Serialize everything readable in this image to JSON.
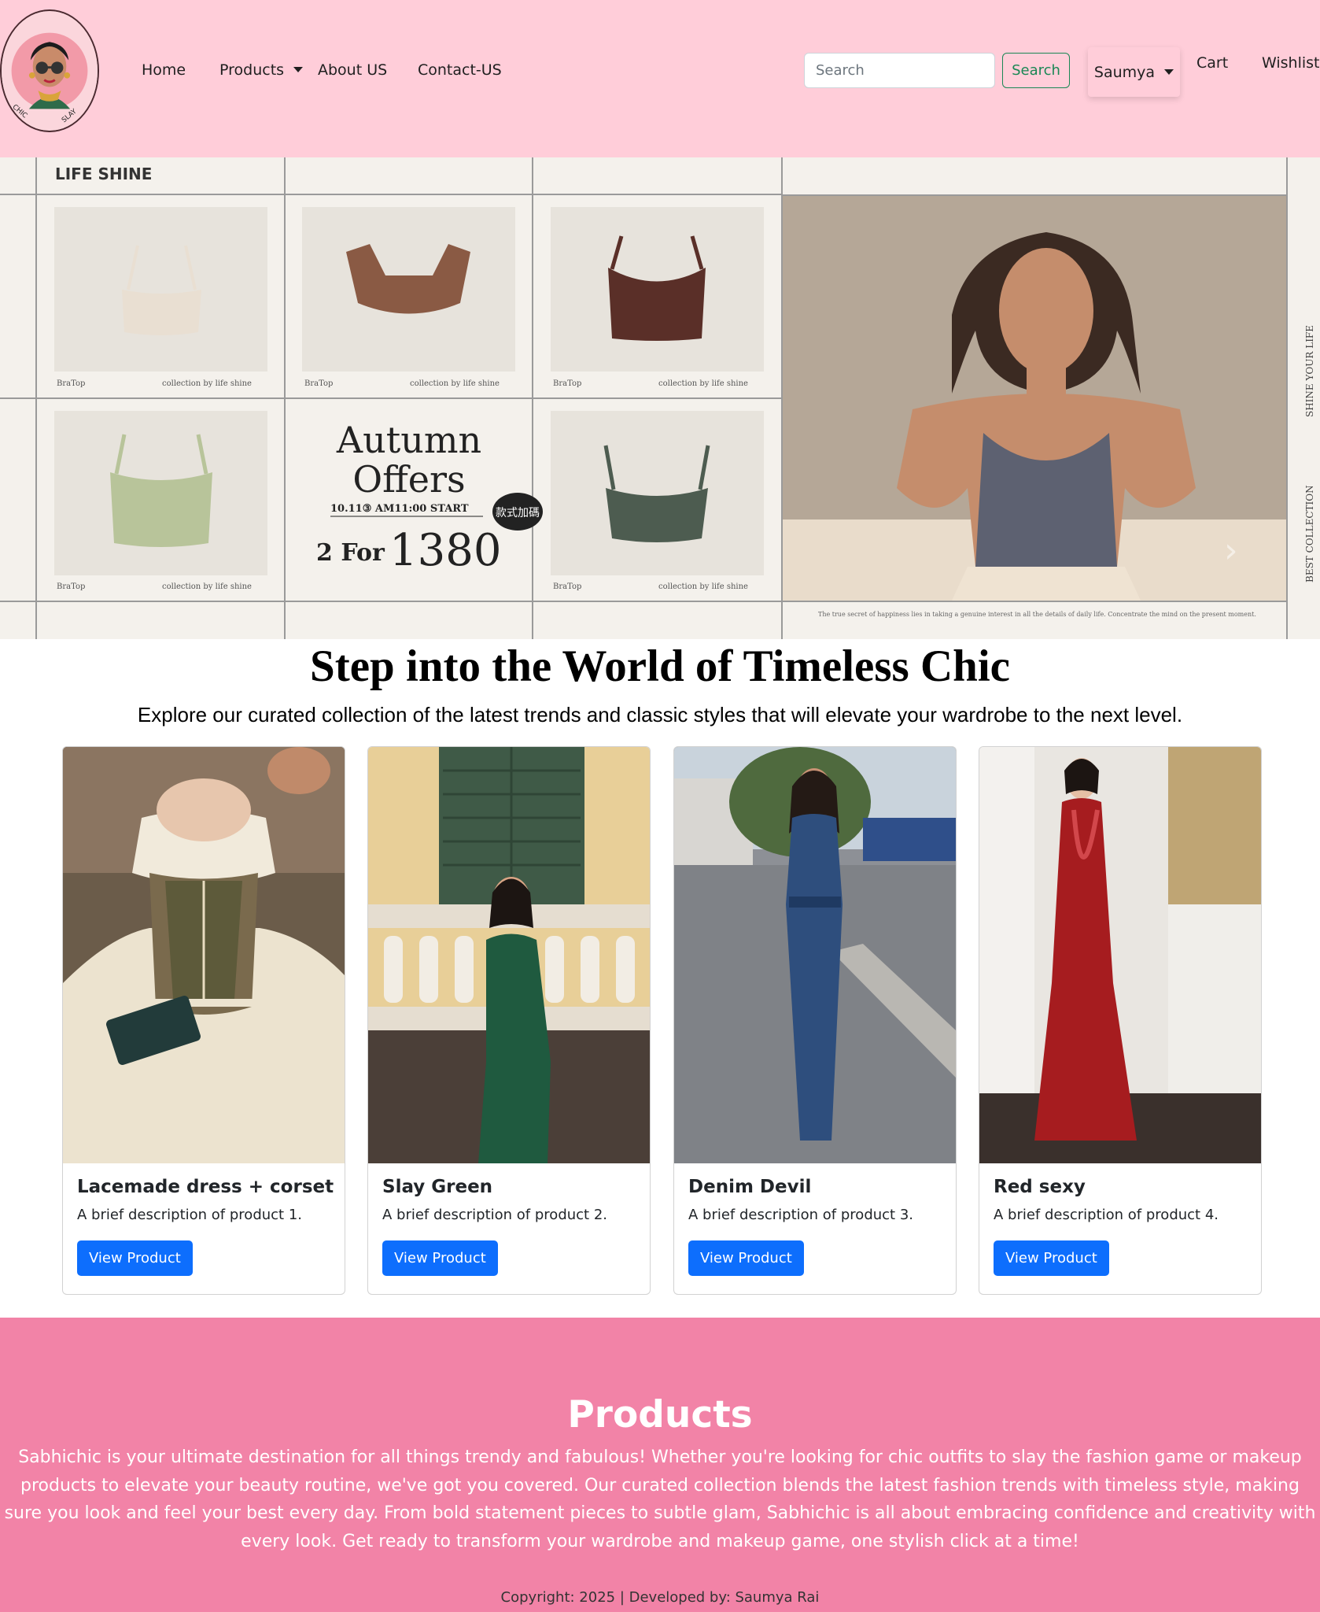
{
  "brand": {
    "logo_text_left": "CHIC",
    "logo_text_right": "SLAY"
  },
  "nav": {
    "home": "Home",
    "products": "Products",
    "about": "About US",
    "contact": "Contact-US",
    "search_placeholder": "Search",
    "search_button": "Search",
    "user": "Saumya",
    "cart": "Cart",
    "wishlist": "Wishlist"
  },
  "hero": {
    "brand": "LIFE SHINE",
    "grid_caption_left": "BraTop",
    "grid_caption_right": "collection by life shine",
    "offer_line1": "Autumn",
    "offer_line2": "Offers",
    "offer_date": "10.11③ AM11:00 START",
    "offer_price_prefix": "2 For",
    "offer_price": "1380",
    "badge": "款式加碼",
    "side_top": "SHINE YOUR LIFE",
    "side_bottom": "BEST COLLECTION",
    "quote": "The true secret of happiness lies in taking a genuine interest in all the details of daily life. Concentrate the mind on the present moment.",
    "next_icon": "›"
  },
  "intro": {
    "headline": "Step into the World of Timeless Chic",
    "subline": "Explore our curated collection of the latest trends and classic styles that will elevate your wardrobe to the next level."
  },
  "cards": [
    {
      "title": "Lacemade dress + corset",
      "text": "A brief description of product 1.",
      "button": "View Product"
    },
    {
      "title": "Slay Green",
      "text": "A brief description of product 2.",
      "button": "View Product"
    },
    {
      "title": "Denim Devil",
      "text": "A brief description of product 3.",
      "button": "View Product"
    },
    {
      "title": "Red sexy",
      "text": "A brief description of product 4.",
      "button": "View Product"
    }
  ],
  "products_section": {
    "title": "Products",
    "text": "Sabhichic is your ultimate destination for all things trendy and fabulous! Whether you're looking for chic outfits to slay the fashion game or makeup products to elevate your beauty routine, we've got you covered. Our curated collection blends the latest fashion trends with timeless style, making sure you look and feel your best every day. From bold statement pieces to subtle glam, Sabhichic is all about embracing confidence and creativity with every look. Get ready to transform your wardrobe and makeup game, one stylish click at a time!",
    "copyright": "Copyright: 2025 | Developed by: Saumya Rai"
  },
  "colors": {
    "navbar_bg": "#ffcdd9",
    "section_bg": "#f283a7",
    "primary_button": "#0d6efd",
    "search_button": "#198754"
  }
}
